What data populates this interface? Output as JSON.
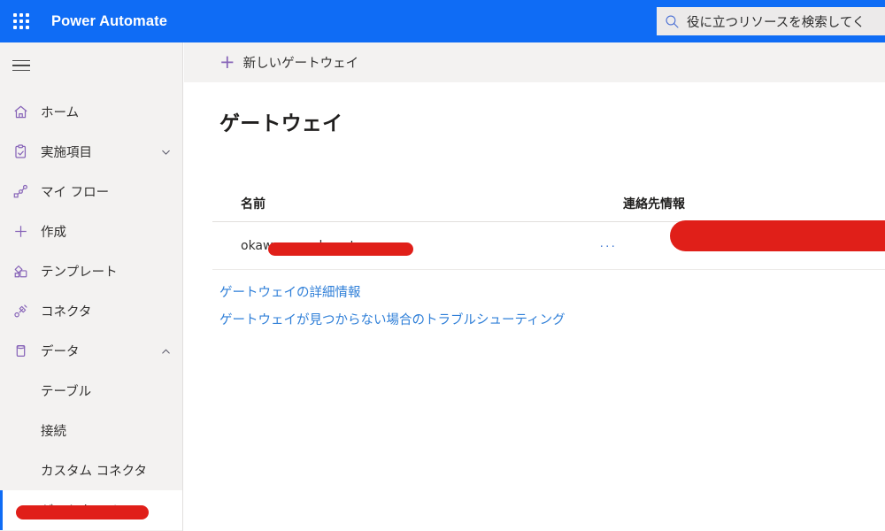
{
  "header": {
    "waffle_icon": "waffle-grid-icon",
    "brand": "Power Automate",
    "search": {
      "icon": "search-icon",
      "placeholder": "役に立つリソースを検索してく",
      "value": "役に立つリソースを検索してく"
    }
  },
  "sidebar": {
    "menu_icon": "hamburger-icon",
    "items": [
      {
        "label": "ホーム",
        "icon": "home-icon",
        "level": "top",
        "chevron": "",
        "selected": false
      },
      {
        "label": "実施項目",
        "icon": "clipboard-check-icon",
        "level": "top",
        "chevron": "chevron-down-icon",
        "selected": false
      },
      {
        "label": "マイ フロー",
        "icon": "flow-icon",
        "level": "top",
        "chevron": "",
        "selected": false
      },
      {
        "label": "作成",
        "icon": "plus-icon",
        "level": "top",
        "chevron": "",
        "selected": false
      },
      {
        "label": "テンプレート",
        "icon": "templates-icon",
        "level": "top",
        "chevron": "",
        "selected": false
      },
      {
        "label": "コネクタ",
        "icon": "connector-icon",
        "level": "top",
        "chevron": "",
        "selected": false
      },
      {
        "label": "データ",
        "icon": "database-icon",
        "level": "top",
        "chevron": "chevron-up-icon",
        "selected": false
      },
      {
        "label": "テーブル",
        "icon": "",
        "level": "sub",
        "chevron": "",
        "selected": false
      },
      {
        "label": "接続",
        "icon": "",
        "level": "sub",
        "chevron": "",
        "selected": false
      },
      {
        "label": "カスタム コネクタ",
        "icon": "",
        "level": "sub",
        "chevron": "",
        "selected": false
      },
      {
        "label": "ゲートウェイ",
        "icon": "",
        "level": "sub",
        "chevron": "",
        "selected": true
      }
    ]
  },
  "main": {
    "commandbar": {
      "new_gateway_label": "新しいゲートウェイ",
      "new_gateway_icon": "plus-icon"
    },
    "page_title": "ゲートウェイ",
    "table": {
      "columns": [
        "名前",
        "連絡先情報"
      ],
      "rows": [
        {
          "name": "okawa-sample-gateway",
          "overflow_menu": "···",
          "contact": ""
        }
      ]
    },
    "links": [
      "ゲートウェイの詳細情報",
      "ゲートウェイが見つからない場合のトラブルシューティング"
    ]
  },
  "annotations": {
    "redaction_color": "#e01f19",
    "items": [
      "sidebar-gateway-redaction",
      "gateway-name-redaction",
      "contact-info-redaction"
    ]
  },
  "colors": {
    "header_blue": "#0f6cf5",
    "accent_purple": "#8764b8",
    "link_blue": "#2f7fd8",
    "sidebar_bg": "#f3f2f1",
    "selection_bar": "#0f6cf5"
  }
}
